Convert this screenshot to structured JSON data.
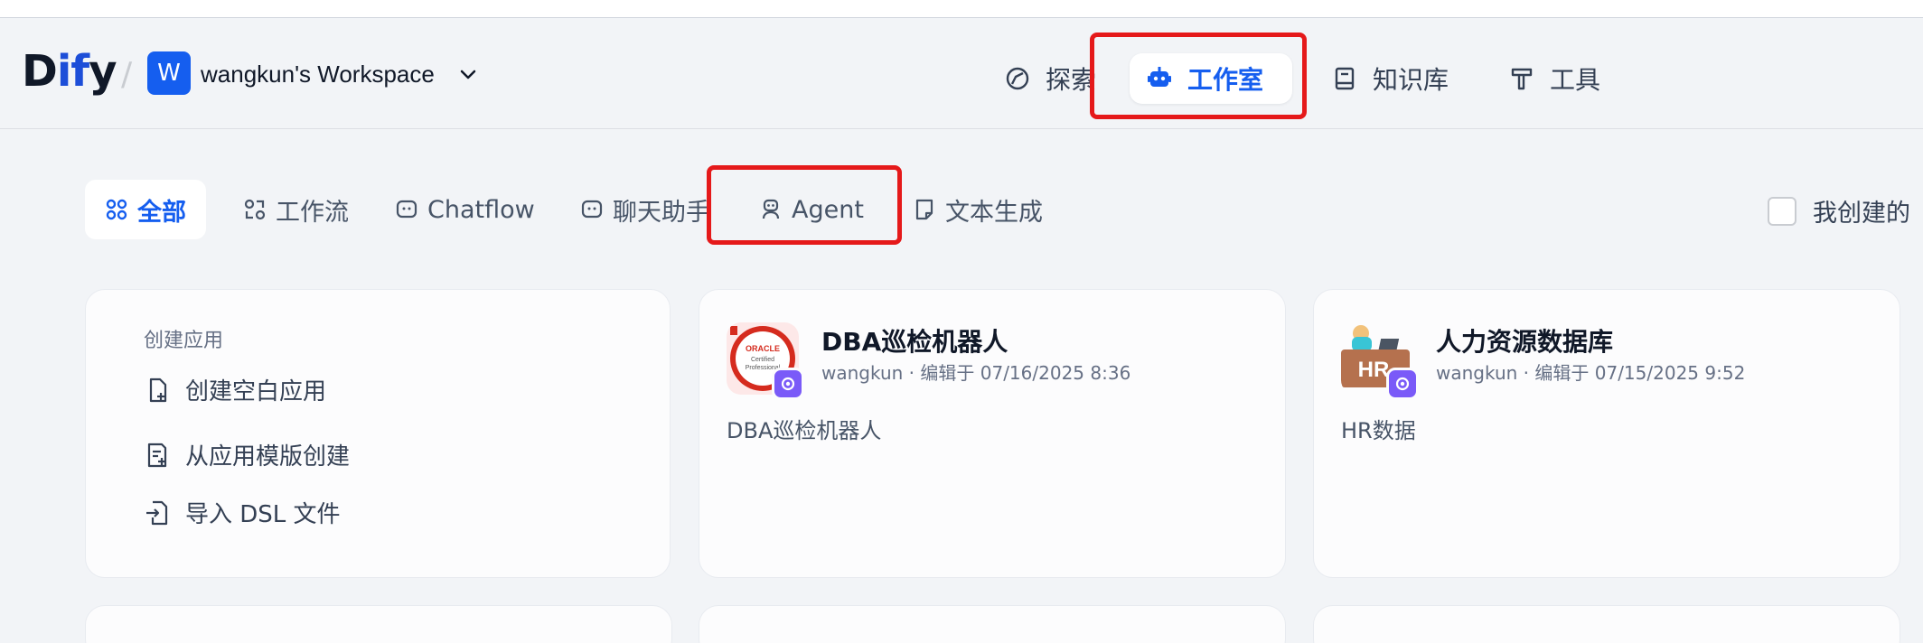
{
  "header": {
    "logo": {
      "prefix": "D",
      "accent": "if",
      "suffix": "y"
    },
    "workspace": {
      "avatar_letter": "W",
      "name": "wangkun's Workspace"
    },
    "nav": [
      {
        "label": "探索",
        "icon": "compass-icon"
      },
      {
        "label": "工作室",
        "icon": "robot-icon",
        "active": true
      },
      {
        "label": "知识库",
        "icon": "book-icon"
      },
      {
        "label": "工具",
        "icon": "hammer-icon"
      }
    ]
  },
  "tabs": [
    {
      "label": "全部",
      "icon": "grid-icon",
      "active": true
    },
    {
      "label": "工作流",
      "icon": "workflow-icon"
    },
    {
      "label": "Chatflow",
      "icon": "chat-bubble-icon"
    },
    {
      "label": "聊天助手",
      "icon": "chat-bot-icon"
    },
    {
      "label": "Agent",
      "icon": "agent-icon"
    },
    {
      "label": "文本生成",
      "icon": "document-icon"
    }
  ],
  "filter": {
    "mine_label": "我创建的"
  },
  "create_app": {
    "title": "创建应用",
    "items": [
      {
        "label": "创建空白应用",
        "icon": "new-file-icon"
      },
      {
        "label": "从应用模版创建",
        "icon": "template-icon"
      },
      {
        "label": "导入 DSL 文件",
        "icon": "import-icon"
      }
    ]
  },
  "apps": [
    {
      "name": "DBA巡检机器人",
      "author": "wangkun",
      "edited": "编辑于 07/16/2025 8:36",
      "description": "DBA巡检机器人",
      "icon_text": "ORACLE Certified Professional"
    },
    {
      "name": "人力资源数据库",
      "author": "wangkun",
      "edited": "编辑于 07/15/2025 9:52",
      "description": "HR数据",
      "icon_text": "HR"
    }
  ],
  "colors": {
    "accent": "#155eef",
    "highlight_box": "#e5191a",
    "badge": "#7a5af8"
  }
}
